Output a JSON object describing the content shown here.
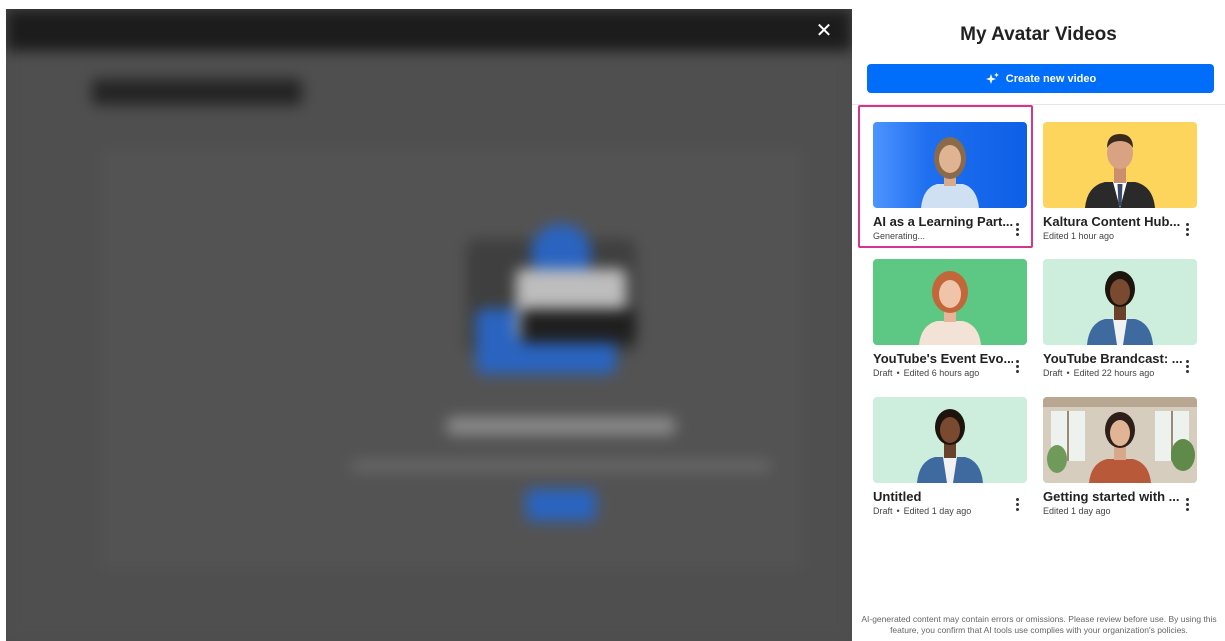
{
  "panel": {
    "title": "My Avatar Videos",
    "create_button": "Create new video",
    "close_icon": "close-icon",
    "disclaimer": "AI-generated content may contain errors or omissions. Please review before use. By using this feature, you confirm that AI tools use complies with your organization's policies."
  },
  "videos": [
    {
      "title": "AI as a Learning Part...",
      "status": "Generating...",
      "edited": "",
      "bg": "#1f73f0",
      "selected": true
    },
    {
      "title": "Kaltura Content Hub...",
      "status": "",
      "edited": "Edited 1 hour ago",
      "bg": "#fdd45c",
      "selected": false
    },
    {
      "title": "YouTube's Event Evo...",
      "status": "Draft",
      "edited": "Edited 6 hours ago",
      "bg": "#5dc784",
      "selected": false
    },
    {
      "title": "YouTube Brandcast: ...",
      "status": "Draft",
      "edited": "Edited 22 hours ago",
      "bg": "#cdeedd",
      "selected": false
    },
    {
      "title": "Untitled",
      "status": "Draft",
      "edited": "Edited 1 day ago",
      "bg": "#cdeedd",
      "selected": false
    },
    {
      "title": "Getting started with ...",
      "status": "",
      "edited": "Edited 1 day ago",
      "bg": "#d7cdbf",
      "selected": false
    }
  ],
  "colors": {
    "accent": "#006efa",
    "selection": "#d6348f"
  }
}
